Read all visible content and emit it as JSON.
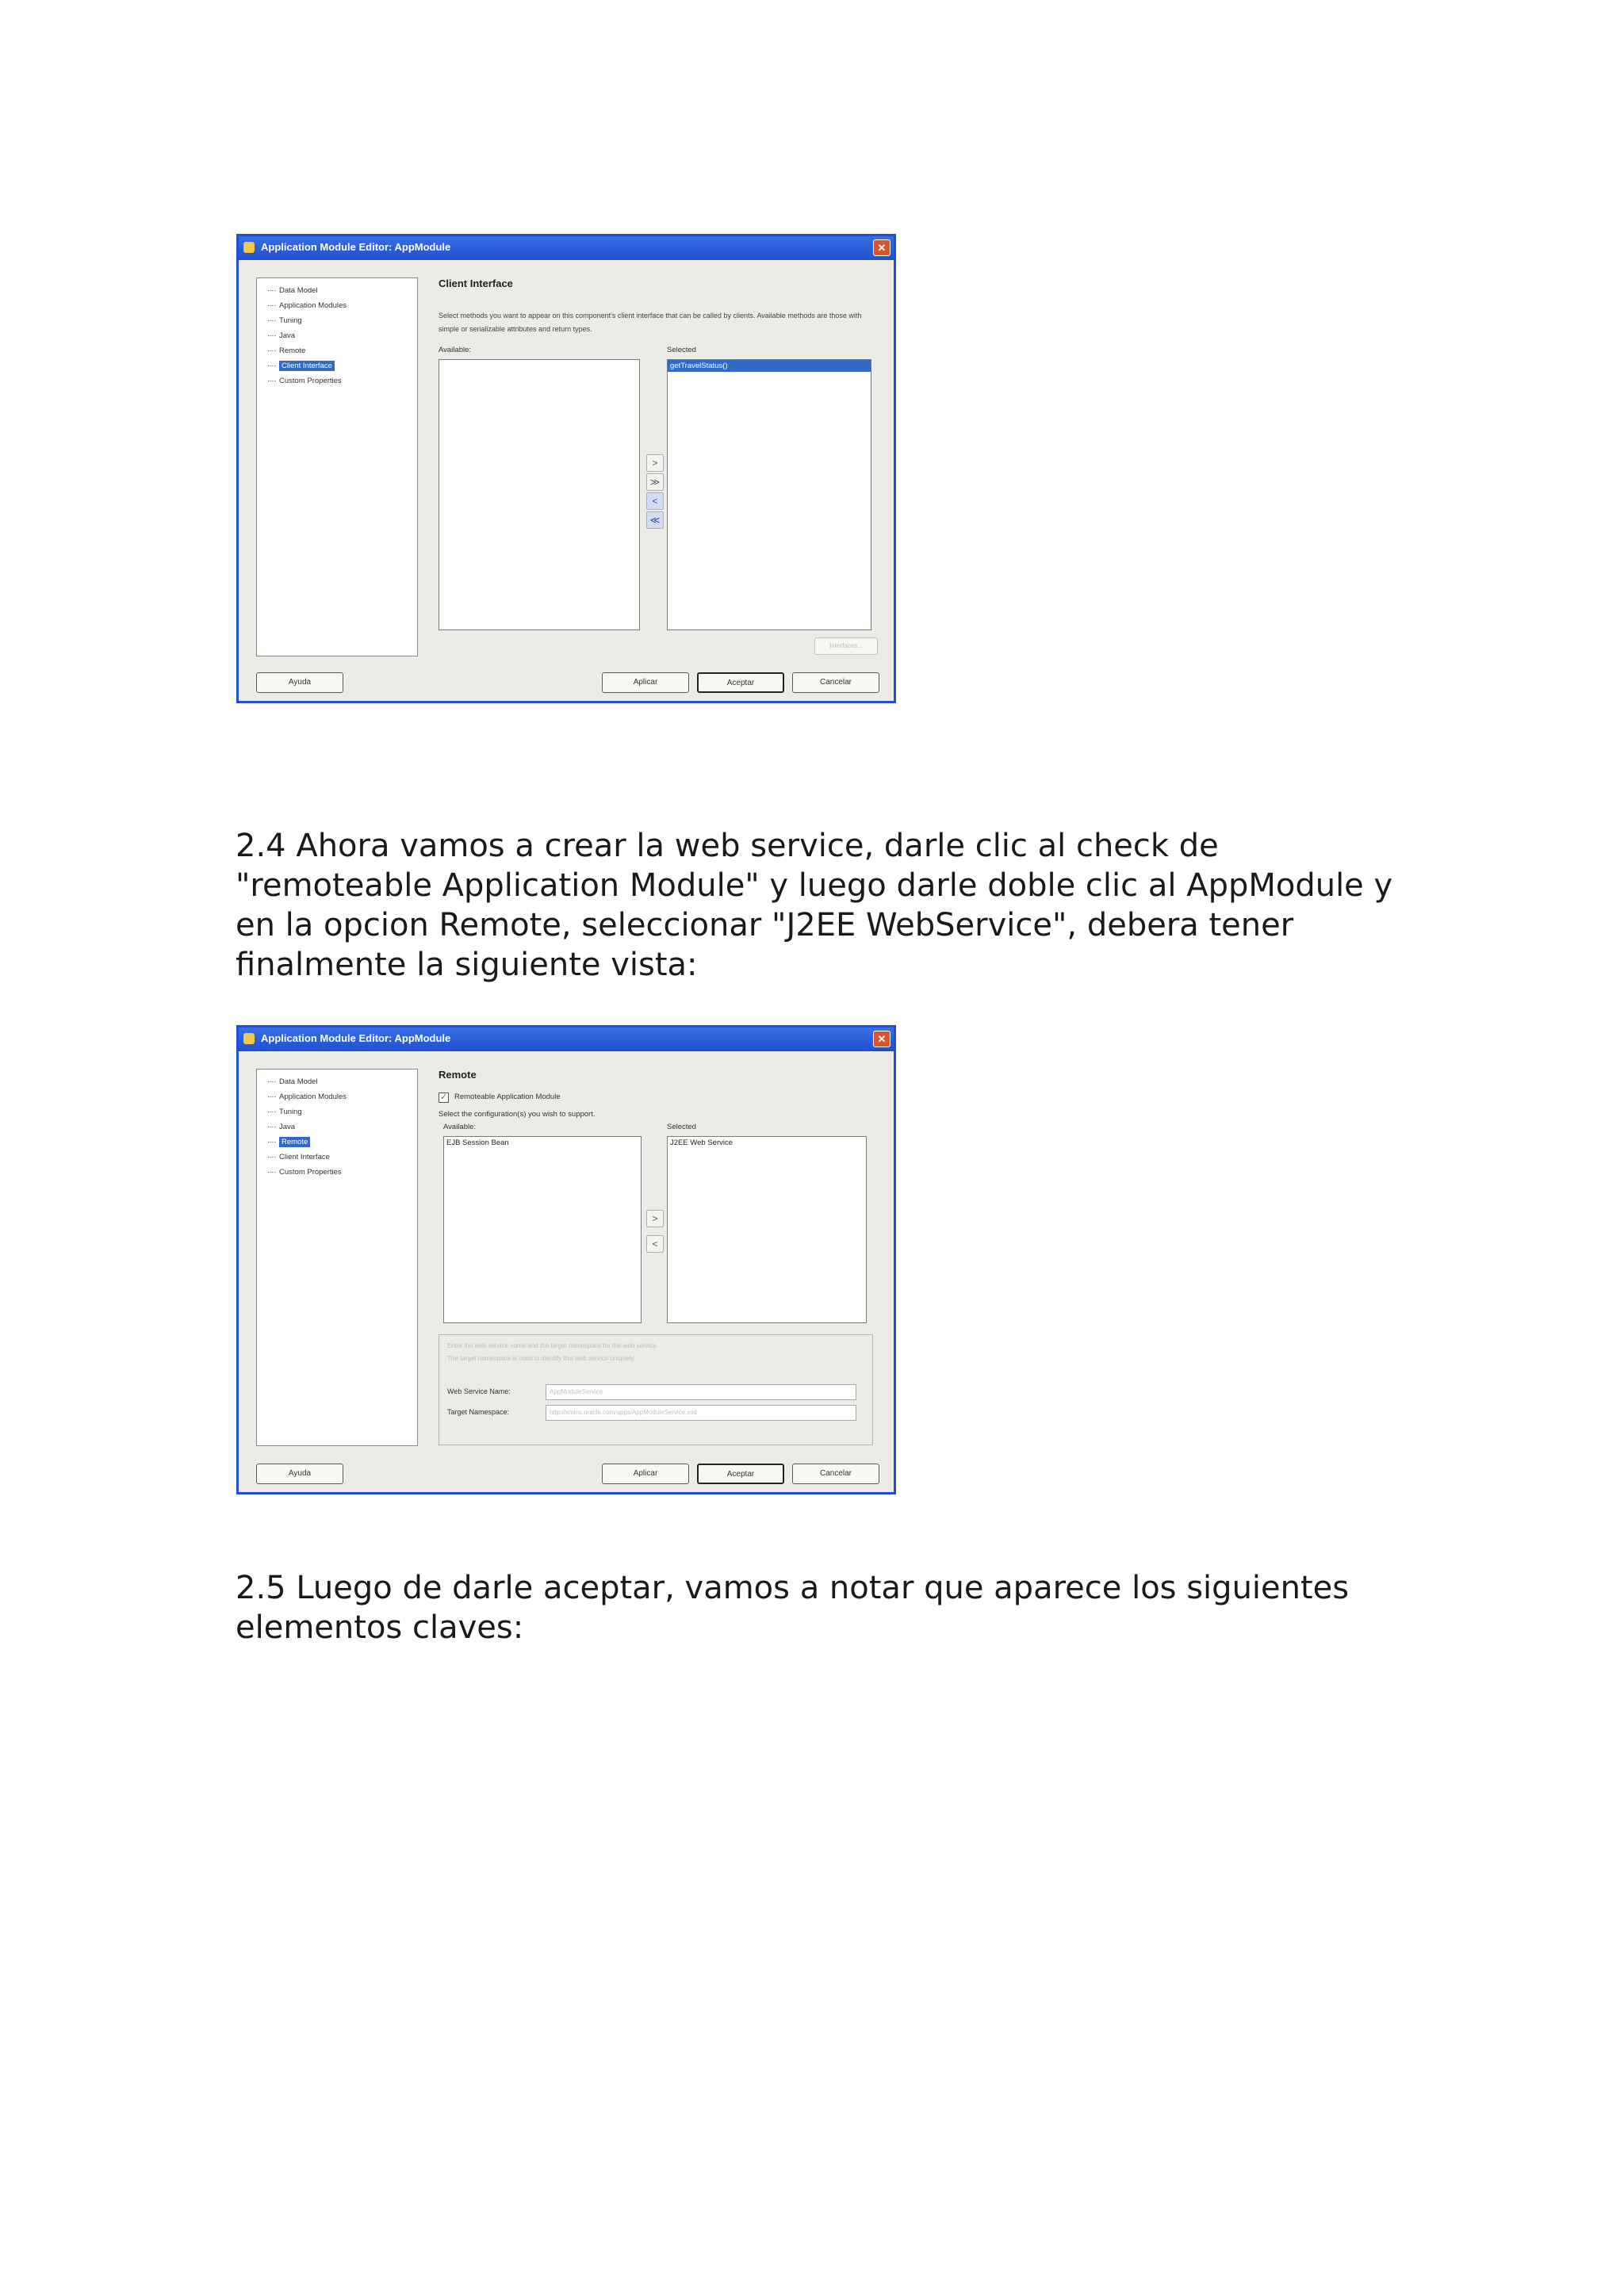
{
  "dialog1": {
    "title": "Application Module Editor: AppModule",
    "close_label": "✕",
    "tree_items": [
      "Data Model",
      "Application Modules",
      "Tuning",
      "Java",
      "Remote",
      "Client Interface",
      "Custom Properties"
    ],
    "section_title": "Client Interface",
    "description": "Select methods you want to appear on this component's client interface that can be called by clients. Available methods are those with simple or serializable attributes and return types.",
    "available_label": "Available:",
    "selected_label": "Selected",
    "selected_items": [
      "getTravelStatus()"
    ],
    "arrows": [
      ">",
      "≫",
      "<",
      "≪"
    ],
    "interfaces_button": "Interfaces...",
    "help_button": "Ayuda",
    "apply_button": "Aplicar",
    "ok_button": "Aceptar",
    "cancel_button": "Cancelar"
  },
  "paragraph1": "2.4 Ahora vamos a crear la web service, darle clic al check de \"remoteable Application Module\" y luego darle doble clic al AppModule y en la opcion Remote, seleccionar \"J2EE WebService\", debera tener finalmente la siguiente vista:",
  "dialog2": {
    "title": "Application Module Editor: AppModule",
    "close_label": "✕",
    "tree_items": [
      "Data Model",
      "Application Modules",
      "Tuning",
      "Java",
      "Remote",
      "Client Interface",
      "Custom Properties"
    ],
    "section_title": "Remote",
    "checkbox_label": "Remoteable Application Module",
    "checkbox_checked": true,
    "config_prompt": "Select the configuration(s) you wish to support.",
    "available_label": "Available:",
    "selected_label": "Selected",
    "available_items": [
      "EJB Session Bean"
    ],
    "selected_items": [
      "J2EE Web Service"
    ],
    "arrows": [
      ">",
      "<"
    ],
    "info_line1": "Enter the web service name and the target namespace for the web service.",
    "info_line2": "The target namespace is used to identify this web service uniquely.",
    "ws_name_label": "Web Service Name:",
    "ws_name_value": "AppModuleService",
    "namespace_label": "Target Namespace:",
    "namespace_value": "http://xmlns.oracle.com/apps/AppModuleService.xsd",
    "help_button": "Ayuda",
    "apply_button": "Aplicar",
    "ok_button": "Aceptar",
    "cancel_button": "Cancelar"
  },
  "paragraph2": "2.5 Luego de darle aceptar, vamos a notar que aparece los siguientes elementos claves:"
}
